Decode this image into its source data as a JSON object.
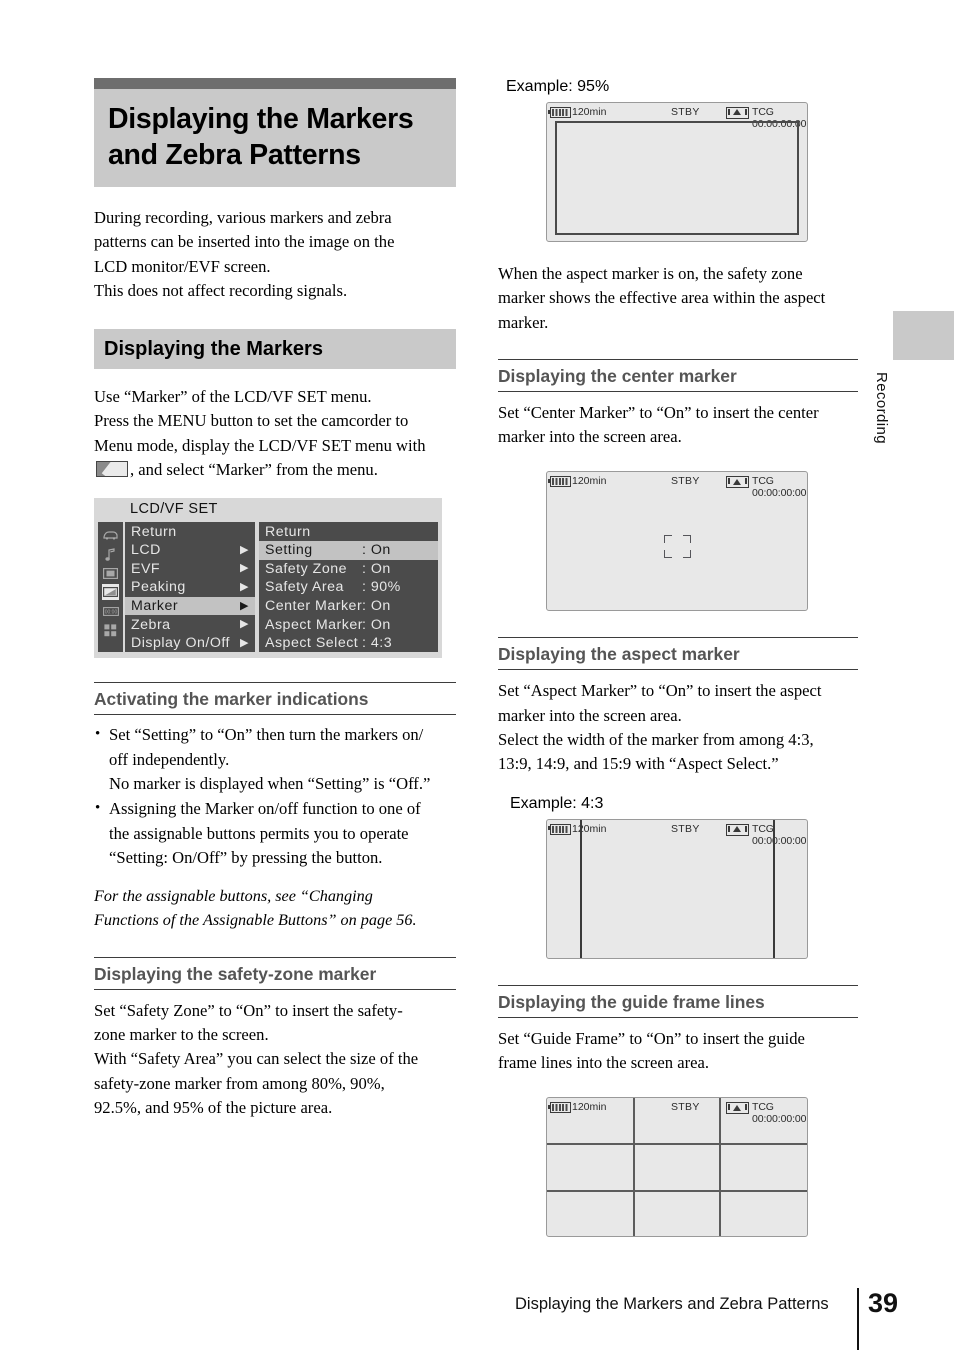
{
  "chapter": {
    "title_line1": "Displaying the Markers",
    "title_line2": "and Zebra Patterns",
    "intro_line1": "During recording, various markers and zebra",
    "intro_line2": "patterns can be inserted into the image on the",
    "intro_line3": "LCD monitor/EVF screen.",
    "intro_line4": "This does not affect recording signals."
  },
  "section_markers": {
    "heading": "Displaying the Markers",
    "body_line1": "Use “Marker” of the LCD/VF SET menu.",
    "body_line2": "Press the MENU button to set the camcorder to",
    "body_line3": "Menu mode, display the LCD/VF SET menu with",
    "body_line4_after_icon": ", and select “Marker” from the menu."
  },
  "menu": {
    "title": "LCD/VF SET",
    "icons": [
      "camera-icon",
      "audio-note-icon",
      "video-film-icon",
      "lcd-vf-icon",
      "timecode-icon",
      "others-grid-icon"
    ],
    "selected_icon_index": 3,
    "left_items": [
      {
        "label": "Return",
        "arrow": "",
        "selected": false
      },
      {
        "label": "LCD",
        "arrow": "▶",
        "selected": false
      },
      {
        "label": "EVF",
        "arrow": "▶",
        "selected": false
      },
      {
        "label": "Peaking",
        "arrow": "▶",
        "selected": false
      },
      {
        "label": "Marker",
        "arrow": "▶",
        "selected": true
      },
      {
        "label": "Zebra",
        "arrow": "▶",
        "selected": false
      },
      {
        "label": "Display On/Off",
        "arrow": "▶",
        "selected": false
      }
    ],
    "right_items": [
      {
        "label": "Return",
        "value": "",
        "selected": false
      },
      {
        "label": "Setting",
        "value": ": On",
        "selected": true
      },
      {
        "label": "Safety Zone",
        "value": ": On",
        "selected": false
      },
      {
        "label": "Safety Area",
        "value": ": 90%",
        "selected": false
      },
      {
        "label": "Center Marker",
        "value": ": On",
        "selected": false
      },
      {
        "label": "Aspect Marker",
        "value": ": On",
        "selected": false
      },
      {
        "label": "Aspect Select",
        "value": ": 4:3",
        "selected": false
      }
    ]
  },
  "activating": {
    "heading": "Activating the marker indications",
    "bullet1_line1": "Set “Setting” to “On” then turn the markers on/",
    "bullet1_line2": "off independently.",
    "bullet1_line3": "No marker is displayed when “Setting” is “Off.”",
    "bullet2_line1": "Assigning the Marker on/off function to one of",
    "bullet2_line2": "the assignable buttons permits you to operate",
    "bullet2_line3": "“Setting: On/Off” by pressing the button.",
    "note_line1": "For the assignable buttons, see “Changing",
    "note_line2": "Functions of the Assignable Buttons” on page 56."
  },
  "safety_zone": {
    "heading": "Displaying the safety-zone marker",
    "line1": "Set “Safety Zone” to “On” to insert the safety-",
    "line2": "zone marker to the screen.",
    "line3": "With “Safety Area” you can select the size of the",
    "line4": "safety-zone marker from among 80%, 90%,",
    "line5": "92.5%, and 95% of the picture area."
  },
  "example_95": {
    "label": "Example: 95%",
    "osd": {
      "battery_icon": "battery-icon",
      "battery_time": "120min",
      "status": "STBY",
      "cassette_icon": "cassette-icon",
      "timecode": "TCG 00:00:00:00"
    },
    "caption_line1": "When the aspect marker is on, the safety zone",
    "caption_line2": "marker shows the effective area within the aspect",
    "caption_line3": "marker."
  },
  "center_marker": {
    "heading": "Displaying the center marker",
    "line1": "Set “Center Marker” to “On” to insert the center",
    "line2": "marker into the screen area.",
    "osd": {
      "battery_time": "120min",
      "status": "STBY",
      "timecode": "TCG 00:00:00:00"
    }
  },
  "aspect_marker": {
    "heading": "Displaying the aspect marker",
    "line1": "Set “Aspect Marker” to “On” to insert the aspect",
    "line2": "marker into the screen area.",
    "line3": "Select the width of the marker from among 4:3,",
    "line4": "13:9, 14:9, and 15:9 with “Aspect Select.”",
    "example_label": "Example: 4:3",
    "osd": {
      "battery_time": "120min",
      "status": "STBY",
      "timecode": "TCG 00:00:00:00"
    }
  },
  "guide_frame": {
    "heading": "Displaying the guide frame lines",
    "line1": "Set “Guide Frame” to “On” to insert the guide",
    "line2": "frame lines into the screen area.",
    "osd": {
      "battery_time": "120min",
      "status": "STBY",
      "timecode": "TCG 00:00:00:00"
    }
  },
  "side_tab": {
    "label": "Recording"
  },
  "footer": {
    "running_title": "Displaying the Markers and Zebra Patterns",
    "page_number": "39"
  },
  "colors": {
    "band": "#c9c9c9",
    "band_top": "#6e6e6e",
    "menu_bg": "#4b4b4b",
    "subhead": "#555555"
  }
}
